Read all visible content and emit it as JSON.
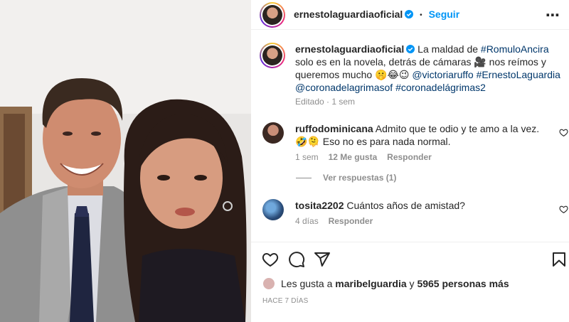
{
  "post": {
    "username": "ernestolaguardiaoficial",
    "follow_label": "Seguir",
    "separator": "•",
    "more_label": "⋯"
  },
  "caption": {
    "username": "ernestolaguardiaoficial",
    "text_1": "La maldad de ",
    "hashtag_1": "#RomuloAncira",
    "text_2": " solo es en la novela, detrás de cámaras 🎥 nos reímos y queremos mucho 🤫😂😉 ",
    "mention_1": "@victoriaruffo",
    "space": " ",
    "hashtag_2": "#ErnestoLaguardia",
    "mention_2": "@coronadelagrimasof",
    "hashtag_3": "#coronadelágrimas2",
    "meta": "Editado · 1 sem"
  },
  "comments": [
    {
      "username": "ruffodominicana",
      "text": "Admito que te odio y te amo a la vez. 🤣🫠 Eso no es para nada normal.",
      "time": "1 sem",
      "likes": "12 Me gusta",
      "reply": "Responder"
    },
    {
      "username": "tosita2202",
      "text": "Cuántos años de amistad?",
      "time": "4 días",
      "reply": "Responder"
    }
  ],
  "view_replies": "Ver respuestas (1)",
  "likes": {
    "prefix": "Les gusta a ",
    "user": "maribelguardia",
    "middle": " y ",
    "count": "5965 personas más"
  },
  "time_ago": "HACE 7 DÍAS",
  "icons": {
    "like": "heart-icon",
    "comment": "comment-icon",
    "share": "share-icon",
    "save": "bookmark-icon",
    "verified": "verified-icon"
  },
  "colors": {
    "link_blue": "#0095f6",
    "hashtag": "#00376b",
    "secondary": "#8e8e8e"
  }
}
